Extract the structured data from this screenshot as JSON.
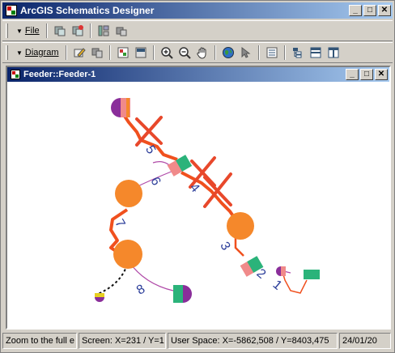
{
  "window": {
    "title": "ArcGIS Schematics Designer",
    "buttons": [
      "_",
      "□",
      "✕"
    ]
  },
  "toolbar1": {
    "file_menu": "File"
  },
  "toolbar2": {
    "diagram_menu": "Diagram"
  },
  "child_window": {
    "title": "Feeder::Feeder-1",
    "buttons": [
      "_",
      "□",
      "✕"
    ]
  },
  "diagram": {
    "labels": [
      "5",
      "6",
      "4",
      "7",
      "3",
      "2",
      "1",
      "8"
    ],
    "colors": {
      "orange": "#f5882b",
      "green": "#2bb37a",
      "pink": "#f08a8a",
      "purple": "#8a2e9a",
      "red": "#e8482b",
      "blue_label": "#2c3e9a"
    }
  },
  "status": {
    "message": "Zoom to the full e",
    "screen": "Screen: X=231 / Y=1",
    "user_space": "User Space: X=-5862,508 / Y=8403,475",
    "date": "24/01/20"
  }
}
